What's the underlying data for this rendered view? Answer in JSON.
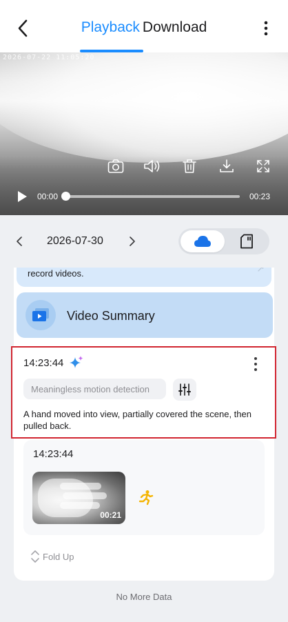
{
  "header": {
    "tab_playback": "Playback",
    "tab_download": "Download",
    "back_icon": "chevron-left-icon",
    "more_icon": "vertical-dots-icon",
    "accent_color": "#1a8cff"
  },
  "player": {
    "overlay_timestamp": "2026-07-22 11:05:20",
    "current_time": "00:00",
    "total_time": "00:23",
    "progress": 0,
    "controls": [
      "camera-icon",
      "volume-icon",
      "trash-icon",
      "download-icon",
      "fullscreen-icon"
    ]
  },
  "date_bar": {
    "date": "2026-07-30",
    "storage_options": [
      "cloud",
      "sd-card"
    ],
    "selected_storage": "cloud"
  },
  "notice": {
    "text": "record videos."
  },
  "summary": {
    "label": "Video Summary"
  },
  "ai_event": {
    "time": "14:23:44",
    "tag": "Meaningless motion detection",
    "description": "A hand moved into view, partially covered the scene, then pulled back.",
    "highlight_color": "#d1242f"
  },
  "event": {
    "time": "14:23:44",
    "clip_duration": "00:21",
    "event_type_icon": "running-person-icon"
  },
  "fold_up": {
    "label": "Fold Up"
  },
  "footer": {
    "no_more": "No More Data"
  }
}
